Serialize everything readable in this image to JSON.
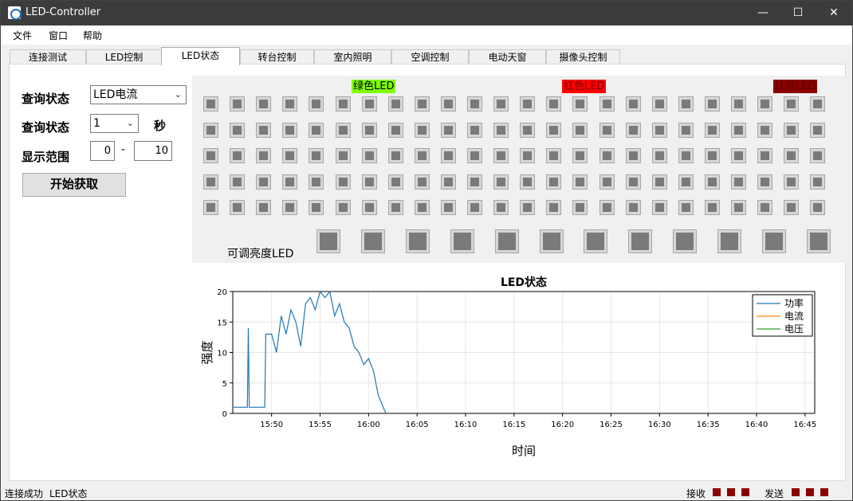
{
  "window": {
    "title": "LED-Controller",
    "controls": [
      "—",
      "☐",
      "✕"
    ]
  },
  "menu": [
    "文件",
    "窗口",
    "帮助"
  ],
  "tabs": [
    "连接测试",
    "LED控制",
    "LED状态",
    "转台控制",
    "室内照明",
    "空调控制",
    "电动天窗",
    "摄像头控制"
  ],
  "active_tab": "LED状态",
  "controls": {
    "query_label1": "查询状态",
    "query_type": "LED电流",
    "query_label2": "查询状态",
    "interval": "1",
    "interval_unit": "秒",
    "range_label": "显示范围",
    "range_from": "0",
    "range_dash": "-",
    "range_to": "10",
    "start_button": "开始获取"
  },
  "led_panel": {
    "green_label": "绿色LED",
    "red_label": "红色LED",
    "ir_label": "红外LED",
    "green_color": "#7fff00",
    "red_color": "#ff0000",
    "ir_color": "#8b0000",
    "grid_rows": 5,
    "grid_cols": 24,
    "adjustable_label": "可调亮度LED",
    "adjustable_count": 12,
    "led_off_color": "#7a7a7a"
  },
  "chart_data": {
    "type": "line",
    "title": "LED状态",
    "xlabel": "时间",
    "ylabel": "强度",
    "ylim": [
      0,
      20
    ],
    "yticks": [
      "0",
      "5",
      "10",
      "15",
      "20"
    ],
    "xticks": [
      "15:50",
      "15:55",
      "16:00",
      "16:05",
      "16:10",
      "16:15",
      "16:20",
      "16:25",
      "16:30",
      "16:35",
      "16:40",
      "16:45"
    ],
    "xlim_minutes": [
      "15:46",
      "16:46"
    ],
    "grid": true,
    "legend": "top-right",
    "series": [
      {
        "name": "功率",
        "color": "#1f77b4",
        "x": [
          "15:46",
          "15:47.5",
          "15:47.6",
          "15:47.7",
          "15:49.3",
          "15:49.4",
          "15:50",
          "15:50.5",
          "15:51",
          "15:51.5",
          "15:52",
          "15:52.5",
          "15:53",
          "15:53.5",
          "15:54",
          "15:54.5",
          "15:55",
          "15:55.5",
          "15:56",
          "15:56.5",
          "15:57",
          "15:57.5",
          "15:58",
          "15:58.5",
          "15:59",
          "15:59.5",
          "16:00",
          "16:00.5",
          "16:01",
          "16:01.5",
          "16:01.8"
        ],
        "y": [
          1,
          1,
          14,
          1,
          1,
          13,
          13,
          10,
          16,
          13,
          17,
          15,
          11,
          18,
          19,
          17,
          20,
          19,
          20,
          16,
          18,
          15,
          14,
          11,
          10,
          8,
          9,
          7,
          3,
          1,
          0
        ]
      },
      {
        "name": "电流",
        "color": "#ff7f0e",
        "x": [],
        "y": []
      },
      {
        "name": "电压",
        "color": "#2ca02c",
        "x": [],
        "y": []
      }
    ]
  },
  "statusbar": {
    "left1": "连接成功",
    "left2": "LED状态",
    "recv": "接收",
    "send": "发送",
    "indicator_color": "#8b0000"
  }
}
